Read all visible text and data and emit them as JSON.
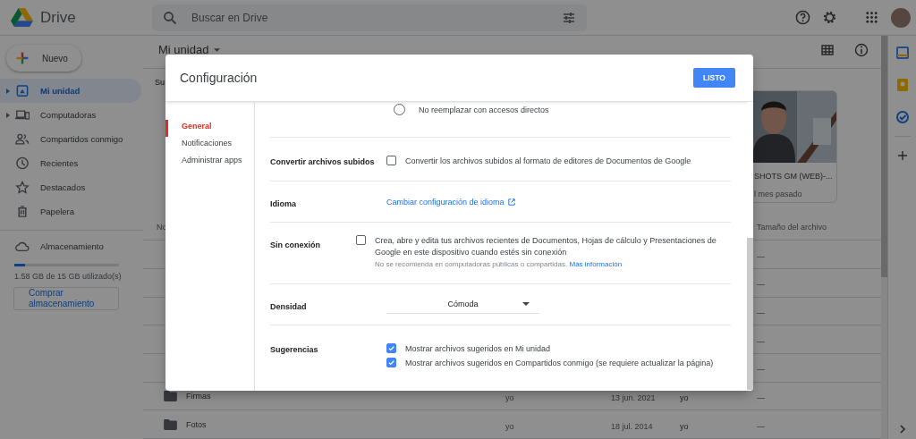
{
  "app": {
    "name": "Drive"
  },
  "search": {
    "placeholder": "Buscar en Drive"
  },
  "new_button": "Nuevo",
  "sidebar": {
    "items": [
      {
        "label": "Mi unidad",
        "selected": true,
        "expandable": true
      },
      {
        "label": "Computadoras",
        "selected": false,
        "expandable": true
      },
      {
        "label": "Compartidos conmigo",
        "selected": false,
        "expandable": false
      },
      {
        "label": "Recientes",
        "selected": false,
        "expandable": false
      },
      {
        "label": "Destacados",
        "selected": false,
        "expandable": false
      },
      {
        "label": "Papelera",
        "selected": false,
        "expandable": false
      }
    ],
    "storage": {
      "label": "Almacenamiento",
      "level": 0.1,
      "usage": "1.58 GB de 15 GB utilizado(s)",
      "buy_button": "Comprar almacenamiento"
    }
  },
  "main": {
    "title": "Mi unidad",
    "section_heading": "Su",
    "card": {
      "kind": "picture",
      "title": "SHOTS GM (WEB)-...",
      "subtitle": "l mes pasado"
    },
    "columns": [
      "No",
      "Tamaño del archivo"
    ],
    "rows": [
      {
        "size": "—"
      },
      {
        "size": "—"
      },
      {
        "size": "—"
      },
      {
        "size": "—"
      },
      {
        "size": "—"
      },
      {
        "name": "Firmas",
        "owner": "yo",
        "modified": "13 jun. 2021",
        "modified_by": "yo",
        "size": "—"
      },
      {
        "name": "Fotos",
        "owner": "yo",
        "modified": "18 jul. 2014",
        "modified_by": "yo",
        "size": "—"
      }
    ]
  },
  "dialog": {
    "title": "Configuración",
    "done_button": "LISTO",
    "nav": [
      {
        "label": "General",
        "selected": true
      },
      {
        "label": "Notificaciones",
        "selected": false
      },
      {
        "label": "Administrar apps",
        "selected": false
      }
    ],
    "sections": [
      {
        "kind": "radio",
        "options": [
          {
            "label": "No reemplazar con accesos directos",
            "selected": false
          }
        ]
      },
      {
        "kind": "checkbox",
        "label": "Convertir archivos subidos",
        "options": [
          {
            "label": "Convertir los archivos subidos al formato de editores de Documentos de Google",
            "checked": false
          }
        ]
      },
      {
        "kind": "link",
        "label": "Idioma",
        "link": "Cambiar configuración de idioma"
      },
      {
        "kind": "offline",
        "label": "Sin conexión",
        "checked": false,
        "text": "Crea, abre y edita tus archivos recientes de Documentos, Hojas de cálculo y Presentaciones de Google en este dispositivo cuando estés sin conexión",
        "note": "No se recomienda en computadoras públicas o compartidas.",
        "note_link": "Más información"
      },
      {
        "kind": "select",
        "label": "Densidad",
        "value": "Cómoda"
      },
      {
        "kind": "checkbox",
        "label": "Sugerencias",
        "options": [
          {
            "label": "Mostrar archivos sugeridos en Mi unidad",
            "checked": true
          },
          {
            "label": "Mostrar archivos sugeridos en Compartidos conmigo (se requiere actualizar la página)",
            "checked": true
          }
        ]
      }
    ]
  }
}
